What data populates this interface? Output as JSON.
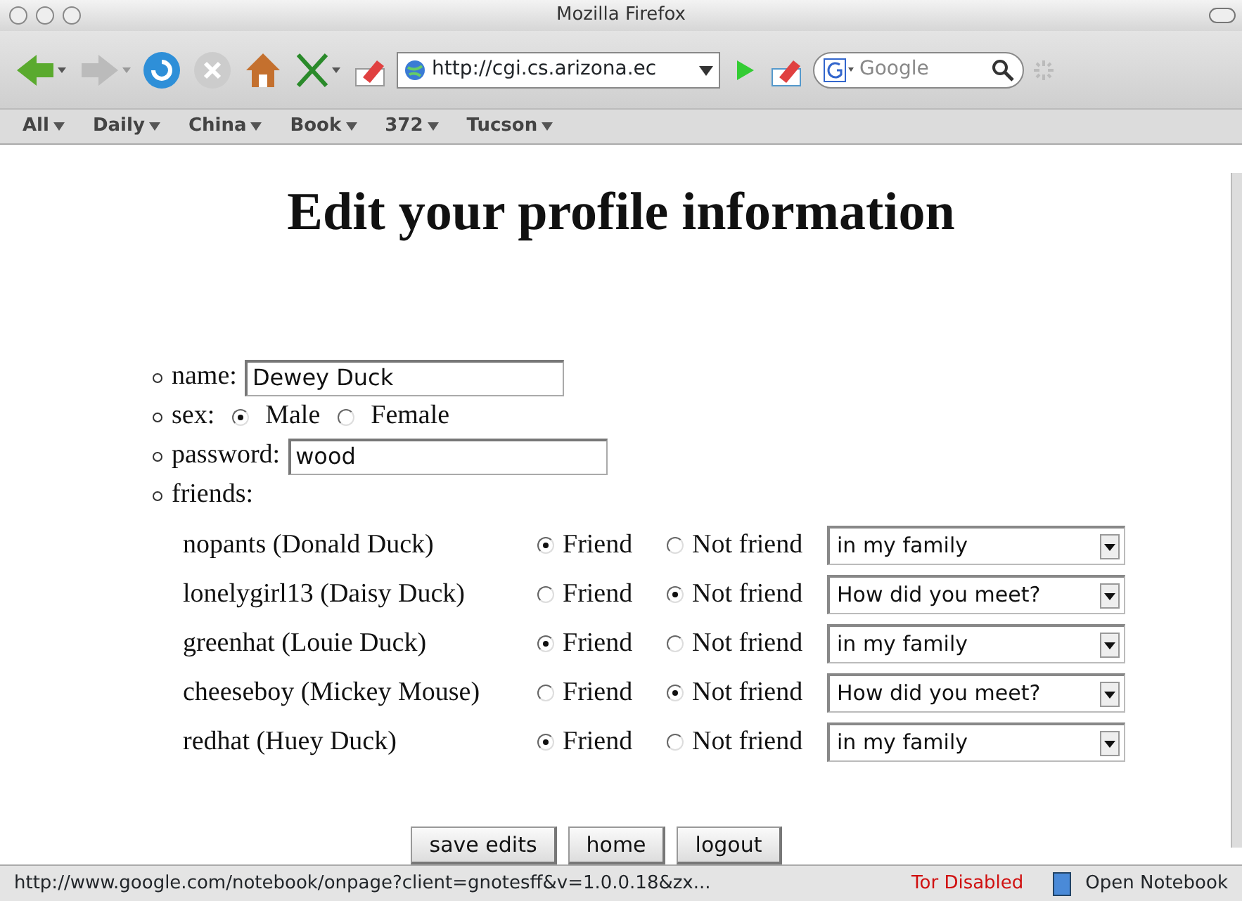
{
  "window": {
    "title": "Mozilla Firefox"
  },
  "toolbar": {
    "url": "http://cgi.cs.arizona.ec",
    "search_placeholder": "Google"
  },
  "bookmarks": [
    {
      "label": "All"
    },
    {
      "label": "Daily"
    },
    {
      "label": "China"
    },
    {
      "label": "Book"
    },
    {
      "label": "372"
    },
    {
      "label": "Tucson"
    }
  ],
  "page": {
    "heading": "Edit your profile information",
    "name": {
      "label": "name:",
      "value": "Dewey Duck"
    },
    "sex": {
      "label": "sex:",
      "options": [
        {
          "label": "Male",
          "selected": true
        },
        {
          "label": "Female",
          "selected": false
        }
      ]
    },
    "password": {
      "label": "password:",
      "value": "wood"
    },
    "friends": {
      "label": "friends:",
      "rows": [
        {
          "name": "nopants (Donald Duck)",
          "options": [
            {
              "label": "Friend",
              "selected": true
            },
            {
              "label": "Not friend",
              "selected": false
            }
          ],
          "how_met": "in my family"
        },
        {
          "name": "lonelygirl13 (Daisy Duck)",
          "options": [
            {
              "label": "Friend",
              "selected": false
            },
            {
              "label": "Not friend",
              "selected": true
            }
          ],
          "how_met": "How did you meet?"
        },
        {
          "name": "greenhat (Louie Duck)",
          "options": [
            {
              "label": "Friend",
              "selected": true
            },
            {
              "label": "Not friend",
              "selected": false
            }
          ],
          "how_met": "in my family"
        },
        {
          "name": "cheeseboy (Mickey Mouse)",
          "options": [
            {
              "label": "Friend",
              "selected": false
            },
            {
              "label": "Not friend",
              "selected": true
            }
          ],
          "how_met": "How did you meet?"
        },
        {
          "name": "redhat (Huey Duck)",
          "options": [
            {
              "label": "Friend",
              "selected": true
            },
            {
              "label": "Not friend",
              "selected": false
            }
          ],
          "how_met": "in my family"
        }
      ]
    },
    "buttons": [
      "save edits",
      "home",
      "logout"
    ]
  },
  "status_bar": {
    "url": "http://www.google.com/notebook/onpage?client=gnotesff&v=1.0.0.18&zx...",
    "tor": "Tor Disabled",
    "notebook": "Open Notebook"
  }
}
